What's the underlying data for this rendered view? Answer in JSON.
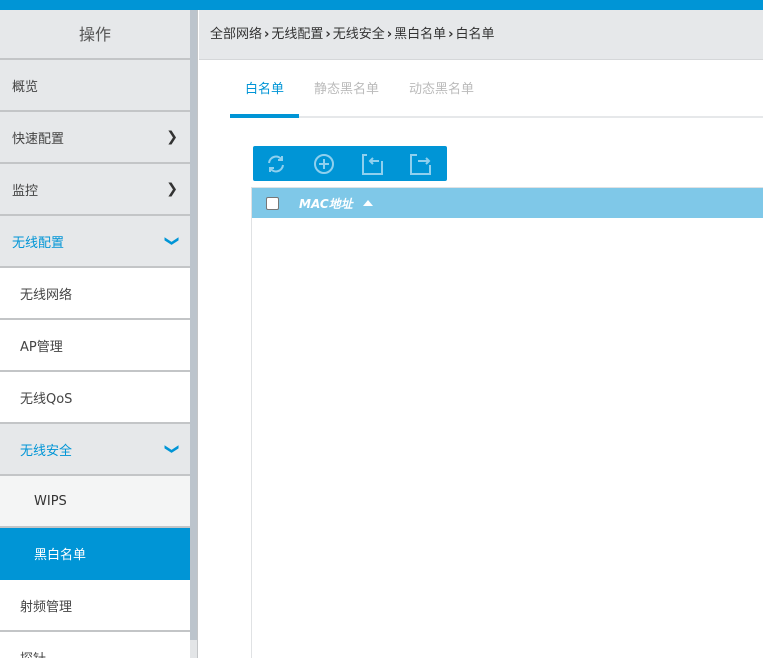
{
  "sidebar": {
    "header": "操作",
    "items": [
      {
        "label": "概览"
      },
      {
        "label": "快速配置"
      },
      {
        "label": "监控"
      },
      {
        "label": "无线配置"
      },
      {
        "label": "无线网络"
      },
      {
        "label": "AP管理"
      },
      {
        "label": "无线QoS"
      },
      {
        "label": "无线安全"
      },
      {
        "label": "WIPS"
      },
      {
        "label": "黑白名单"
      },
      {
        "label": "射频管理"
      },
      {
        "label": "探针"
      }
    ]
  },
  "breadcrumb": [
    "全部网络",
    "无线配置",
    "无线安全",
    "黑白名单",
    "白名单"
  ],
  "tabs": [
    {
      "label": "白名单"
    },
    {
      "label": "静态黑名单"
    },
    {
      "label": "动态黑名单"
    }
  ],
  "toolbar": {
    "icons": [
      "refresh-icon",
      "add-icon",
      "import-icon",
      "export-icon"
    ]
  },
  "table": {
    "columns": [
      "MAC地址"
    ]
  },
  "colors": {
    "accent": "#0095d6",
    "header": "#7fc8e8"
  }
}
